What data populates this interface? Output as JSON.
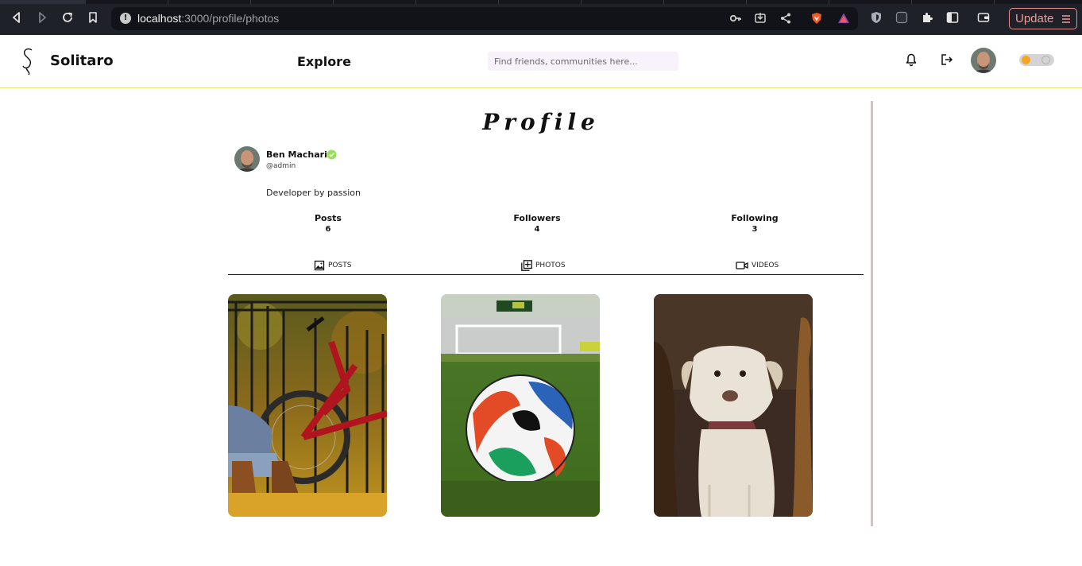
{
  "browser": {
    "url_host": "localhost",
    "url_path": ":3000/profile/photos",
    "update_label": "Update"
  },
  "header": {
    "brand": "Solitaro",
    "explore": "Explore",
    "search_placeholder": "Find friends, communities here..."
  },
  "profile": {
    "title": "Profile",
    "name": "Ben Macharia",
    "handle": "@admin",
    "bio": "Developer by passion",
    "stats": [
      {
        "label": "Posts",
        "value": "6"
      },
      {
        "label": "Followers",
        "value": "4"
      },
      {
        "label": "Following",
        "value": "3"
      }
    ],
    "tabs": [
      {
        "label": "POSTS",
        "icon": "image-icon"
      },
      {
        "label": "PHOTOS",
        "icon": "photos-icon"
      },
      {
        "label": "VIDEOS",
        "icon": "video-icon"
      }
    ],
    "photos": [
      {
        "subject": "bicycle"
      },
      {
        "subject": "football"
      },
      {
        "subject": "dogs"
      }
    ]
  },
  "colors": {
    "header_border": "#f0e170",
    "toggle_knob": "#f5a623",
    "verified": "#9be05a",
    "update_accent": "#f29a96"
  }
}
